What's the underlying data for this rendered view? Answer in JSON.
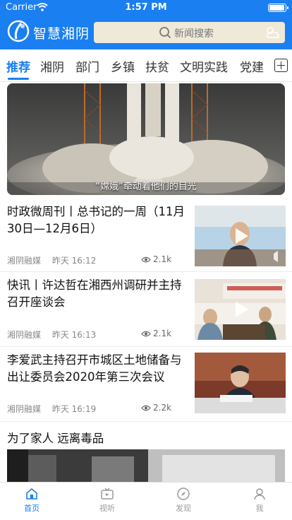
{
  "status": {
    "carrier": "Carrier",
    "time": "1:57 PM",
    "battery_level": 1.0
  },
  "app": {
    "title": "智慧湘阴"
  },
  "search": {
    "placeholder": "新闻搜索"
  },
  "tabs": [
    {
      "label": "推荐",
      "active": true
    },
    {
      "label": "湘阴"
    },
    {
      "label": "部门"
    },
    {
      "label": "乡镇"
    },
    {
      "label": "扶贫"
    },
    {
      "label": "文明实践"
    },
    {
      "label": "党建"
    }
  ],
  "hero": {
    "caption": "“嫦娥”牵动着他们的目光"
  },
  "articles": [
    {
      "title": "时政微周刊丨总书记的一周（11月30日—12月6日）",
      "source": "湘阴融媒",
      "time": "昨天 16:12",
      "views": "2.1k"
    },
    {
      "title": "快讯丨许达哲在湘西州调研并主持召开座谈会",
      "source": "湘阴融媒",
      "time": "昨天 16:13",
      "views": "2.1k"
    },
    {
      "title": "李爱武主持召开市城区土地储备与出让委员会2020年第三次会议",
      "source": "湘阴融媒",
      "time": "昨天 16:19",
      "views": "2.2k"
    },
    {
      "title": "为了家人 远离毒品"
    }
  ],
  "bottom_nav": [
    {
      "label": "首页",
      "icon": "home-icon",
      "active": true
    },
    {
      "label": "视听",
      "icon": "tv-icon"
    },
    {
      "label": "发现",
      "icon": "compass-icon"
    },
    {
      "label": "我",
      "icon": "person-icon"
    }
  ],
  "colors": {
    "accent": "#1a7ff0",
    "search_bg": "#efe9d8"
  }
}
